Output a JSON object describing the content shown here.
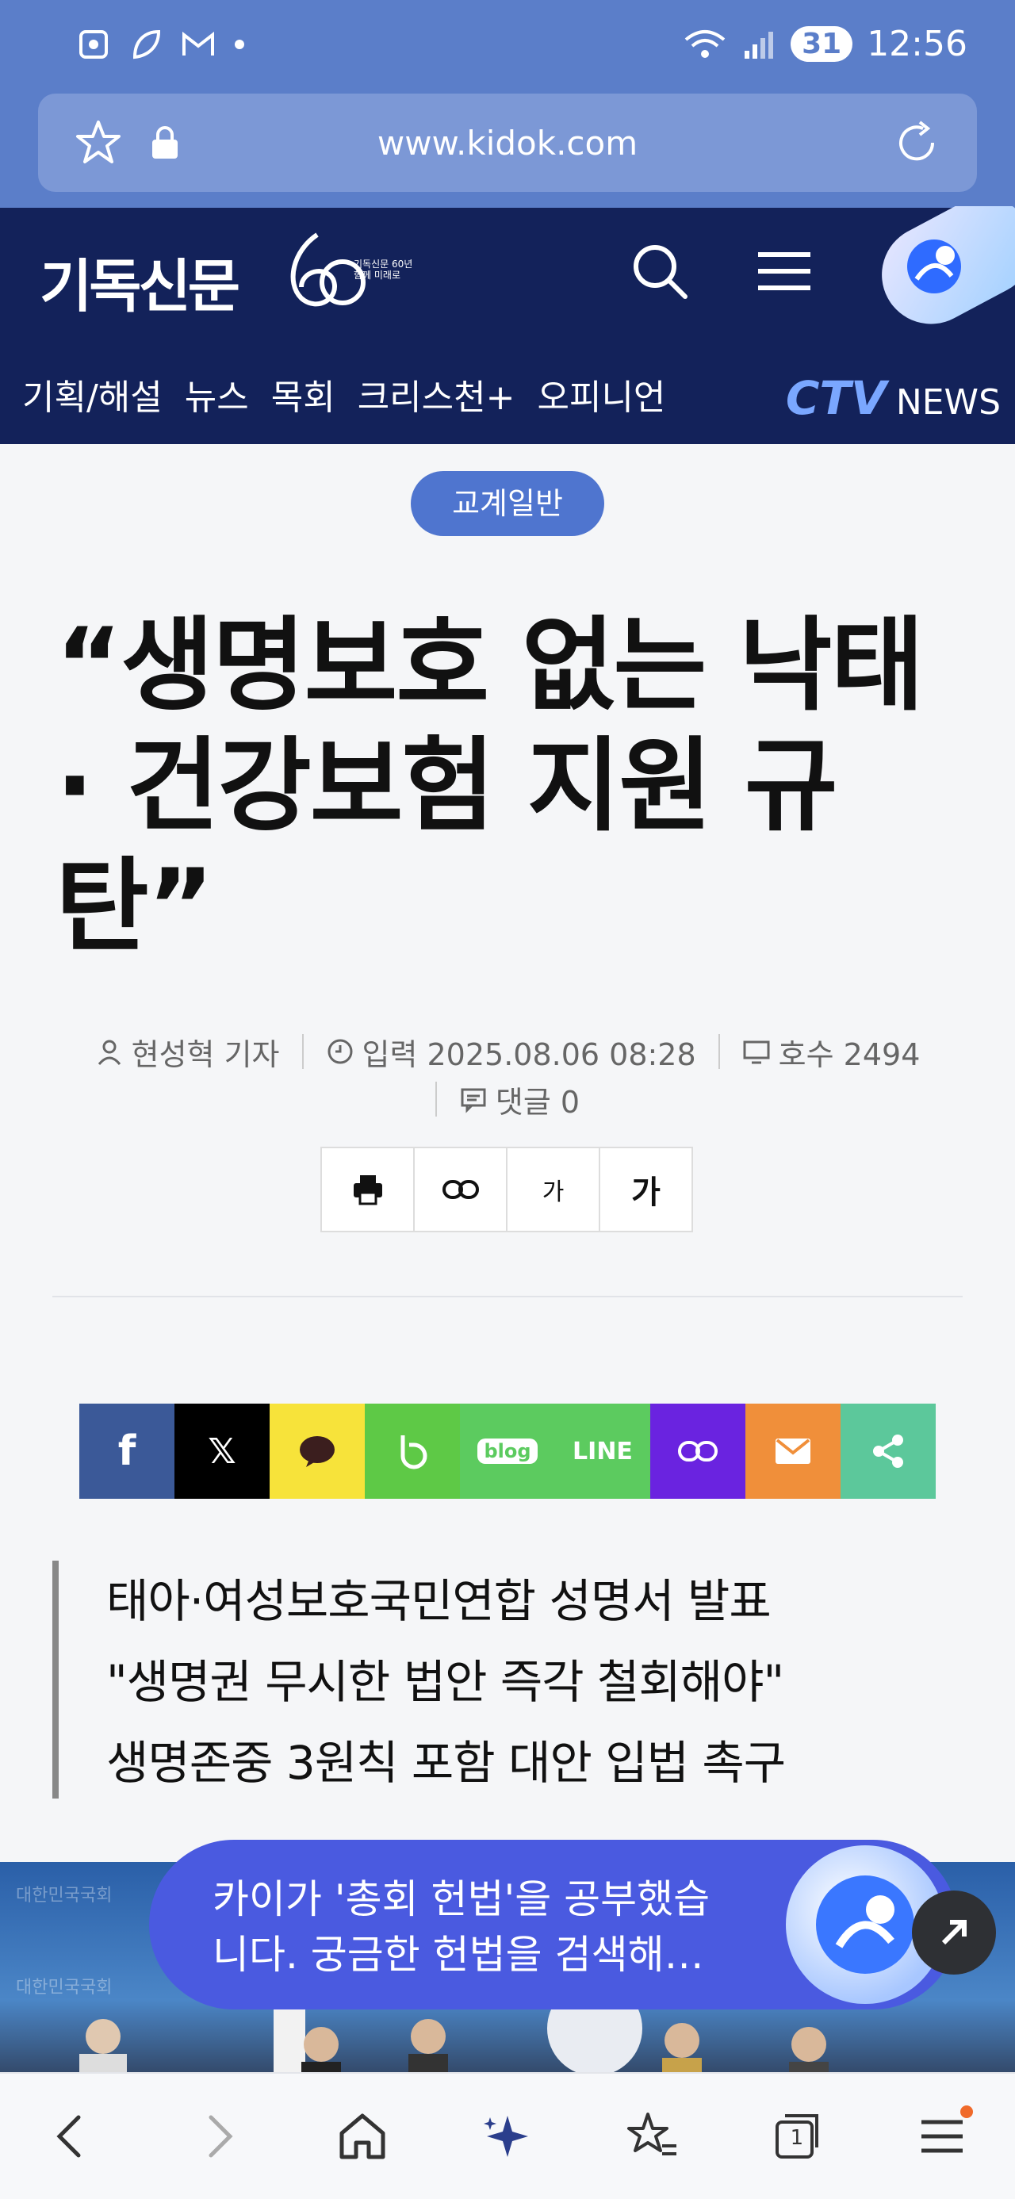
{
  "status_bar": {
    "time": "12:56",
    "battery": "31"
  },
  "url_bar": {
    "url": "www.kidok.com"
  },
  "header": {
    "logo_text": "기독신문",
    "logo_sub_line1": "기독신문 60년",
    "logo_sub_line2": "함께 미래로",
    "nav": [
      "기획/해설",
      "뉴스",
      "목회",
      "크리스천+",
      "오피니언"
    ],
    "ctv": "CTV",
    "ctv_news": "NEWS"
  },
  "article": {
    "category": "교계일반",
    "headline_line1": "“생명보호 없는 낙태",
    "headline_line2": "· 건강보험 지원 규",
    "headline_line3": "탄”",
    "reporter": "현성혁 기자",
    "date_label": "입력 2025.08.06 08:28",
    "issue_label": "호수 2494",
    "comments_label": "댓글 0",
    "font_small": "가",
    "font_large": "가",
    "summary": [
      "태아·여성보호국민연합 성명서 발표",
      "\"생명권 무시한 법안 즉각 철회해야\"",
      "생명존중 3원칙 포함 대안 입법 촉구"
    ]
  },
  "share": [
    {
      "name": "facebook",
      "label": "f",
      "color": "#3b5998"
    },
    {
      "name": "x",
      "label": "𝕏",
      "color": "#000000"
    },
    {
      "name": "kakaotalk",
      "label": "",
      "color": "#f7e33a"
    },
    {
      "name": "band",
      "label": "b",
      "color": "#5ec946"
    },
    {
      "name": "blog",
      "label": "blog",
      "color": "#5ccb5f"
    },
    {
      "name": "line",
      "label": "LINE",
      "color": "#5ccb5f"
    },
    {
      "name": "link",
      "label": "",
      "color": "#6a23e0"
    },
    {
      "name": "email",
      "label": "",
      "color": "#f08f3a"
    },
    {
      "name": "share",
      "label": "",
      "color": "#5cc89b"
    }
  ],
  "ai_popup": {
    "line1": "카이가 '총회 헌법'을 공부했습",
    "line2": "니다. 궁금한 헌법을 검색해…"
  },
  "photo": {
    "backdrop_text": "대한민국국회"
  },
  "bottom_bar": {
    "tabs_count": "1"
  }
}
